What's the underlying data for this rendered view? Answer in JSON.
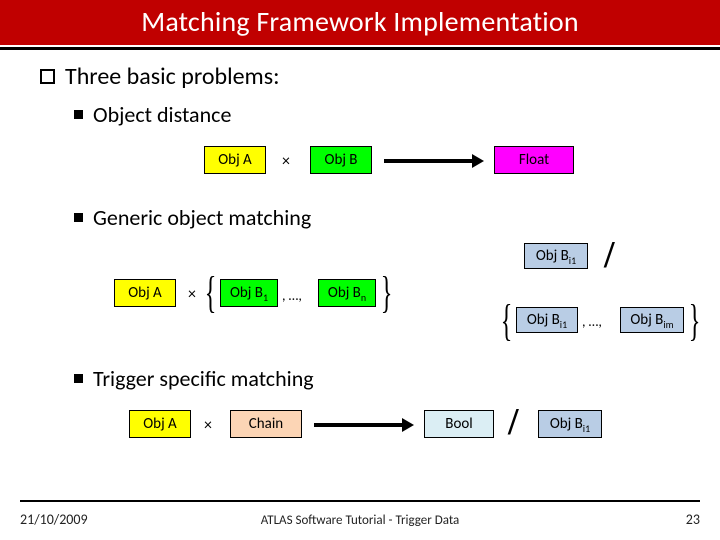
{
  "title": "Matching Framework Implementation",
  "bullet": "Three basic problems:",
  "sub1": "Object distance",
  "sub2": "Generic object matching",
  "sub3": "Trigger specific matching",
  "labels": {
    "objA": "Obj A",
    "objB": "Obj B",
    "float": "Float",
    "bool": "Bool",
    "chain": "Chain",
    "objB1": "Obj B",
    "objBn": "Obj B",
    "objBi1_top": "Obj B",
    "objBi1": "Obj B",
    "objBim": "Obj B",
    "objBi1_r3": "Obj B",
    "times": "×",
    "ellipsis": ", …,",
    "sub_1": "1",
    "sub_n": "n",
    "sub_i1": "i1",
    "sub_im": "im"
  },
  "footer": {
    "date": "21/10/2009",
    "center": "ATLAS Software Tutorial - Trigger Data",
    "page": "23"
  }
}
